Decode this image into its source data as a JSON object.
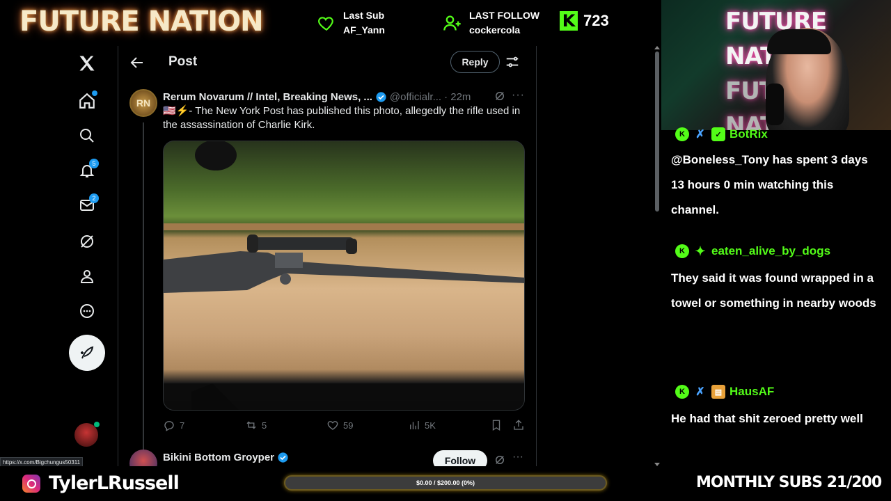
{
  "stream": {
    "logo_text": "FUTURE NATION",
    "last_sub_label": "Last Sub",
    "last_sub_name": "AF_Yann",
    "last_follow_label": "LAST FOLLOW",
    "last_follow_name": "cockercola",
    "viewer_count": "723",
    "cam_sign_text": "FUTURE NATION",
    "instagram_name": "TylerLRussell",
    "goal_text": "$0.00 / $200.00 (0%)",
    "goal_progress": 0,
    "monthly_subs": "MONTHLY SUBS 21/200"
  },
  "x_app": {
    "badges": {
      "notifications": "5",
      "messages": "2"
    },
    "header": {
      "title": "Post",
      "reply_label": "Reply"
    },
    "tweet": {
      "avatar_initials": "RN",
      "name": "Rerum Novarum // Intel, Breaking News, ...",
      "handle": "@officialr...",
      "time": "· 22m",
      "text": "🇺🇸⚡- The New York Post has published this photo, allegedly the rifle used in the assassination of Charlie Kirk.",
      "replies": "7",
      "reposts": "5",
      "likes": "59",
      "views": "5K"
    },
    "next_tweet": {
      "name": "Bikini Bottom Groyper",
      "follow_label": "Follow"
    },
    "hover_url": "https://x.com/Bigchungus50311"
  },
  "chat": {
    "messages": [
      {
        "user": "BotRix",
        "text": "@Boneless_Tony has spent 3 days 13 hours 0 min watching this channel."
      },
      {
        "user": "eaten_alive_by_dogs",
        "text": "They said it was found wrapped in a towel or something in nearby woods"
      },
      {
        "user": "HausAF",
        "text": "He had that shit zeroed pretty well"
      }
    ]
  },
  "colors": {
    "kick_green": "#53fc18",
    "x_blue": "#1d9bf0",
    "x_text": "#e7e9ea",
    "x_muted": "#71767b"
  }
}
